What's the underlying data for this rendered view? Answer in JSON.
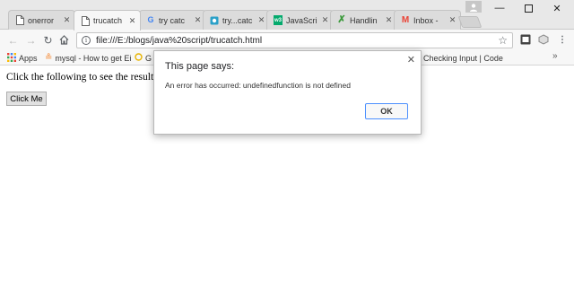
{
  "tabs": [
    {
      "title": "onerror",
      "icon": "page-icon",
      "active": false
    },
    {
      "title": "trucatch",
      "icon": "page-icon",
      "active": true
    },
    {
      "title": "try catc",
      "icon": "google-icon",
      "active": false
    },
    {
      "title": "try...catc",
      "icon": "site-icon",
      "active": false
    },
    {
      "title": "JavaScri",
      "icon": "w3-icon",
      "active": false
    },
    {
      "title": "Handlin",
      "icon": "x-logo-icon",
      "active": false
    },
    {
      "title": "Inbox - ",
      "icon": "gmail-icon",
      "active": false
    }
  ],
  "tab_close_glyph": "✕",
  "toolbar": {
    "url": "file:///E:/blogs/java%20script/trucatch.html"
  },
  "bookmarks": [
    {
      "label": "Apps",
      "icon": "apps-grid-icon"
    },
    {
      "label": "mysql - How to get Ei",
      "icon": "stack-icon"
    },
    {
      "label": "G",
      "icon": "circle-icon"
    },
    {
      "label": "Checking Input | Code",
      "icon": ""
    }
  ],
  "bookmarks_more": "»",
  "content": {
    "prompt_text": "Click the following to see the result:",
    "button_label": "Click Me"
  },
  "dialog": {
    "title": "This page says:",
    "message": "An error has occurred: undefinedfunction is not defined",
    "ok_label": "OK",
    "close_glyph": "✕"
  },
  "colors": {
    "titlebar": "#e8e8e8",
    "active_tab": "#f7f7f7",
    "ok_border": "#4d90fe",
    "google_blue": "#4285f4",
    "gmail_red": "#ea4335",
    "w3_green": "#04aa6d"
  }
}
